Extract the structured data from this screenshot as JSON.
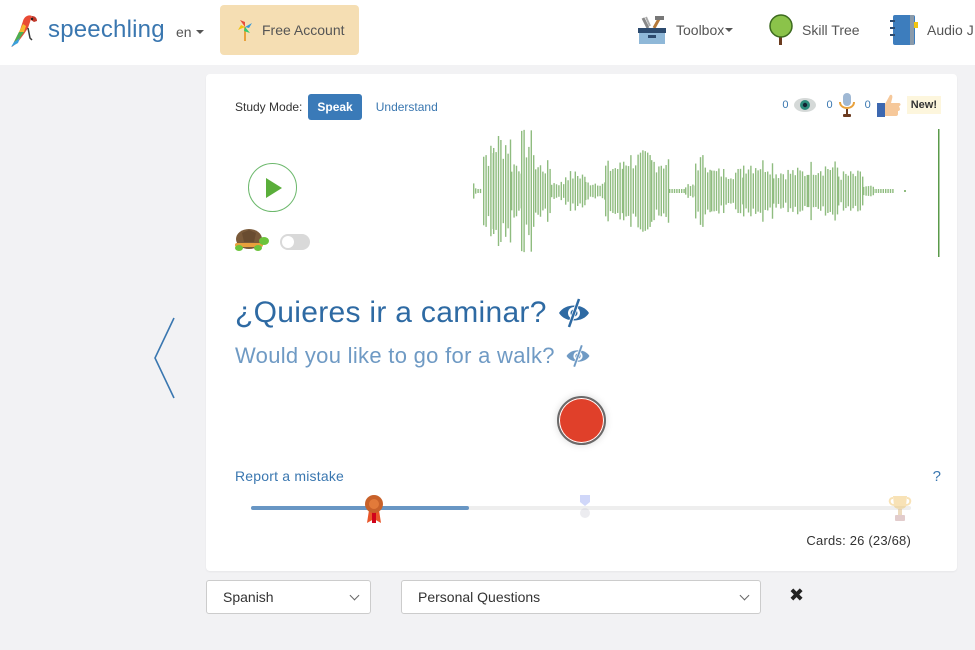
{
  "navbar": {
    "brand": "speechling",
    "language": "en",
    "free_account": "Free Account",
    "items": [
      {
        "label": "Toolbox",
        "icon": "toolbox-icon",
        "has_dropdown": true
      },
      {
        "label": "Skill Tree",
        "icon": "tree-icon",
        "has_dropdown": false
      },
      {
        "label": "Audio J",
        "icon": "notebook-icon",
        "has_dropdown": false
      }
    ]
  },
  "card": {
    "study_mode_label": "Study Mode:",
    "modes": [
      {
        "label": "Speak",
        "active": true
      },
      {
        "label": "Understand",
        "active": false
      }
    ],
    "stats": {
      "viewed": "0",
      "recorded": "0",
      "liked": "0",
      "new_badge": "New!"
    },
    "slow_audio_toggle": false,
    "target_sentence": "¿Quieres ir a caminar?",
    "native_sentence": "Would you like to go for a walk?",
    "report_mistake": "Report a mistake",
    "help": "?",
    "progress": {
      "fraction": 0.33,
      "milestones": [
        "bronze-medal",
        "silver-medal",
        "gold-trophy"
      ]
    },
    "cards_count": "Cards: 26 (23/68)"
  },
  "filters": {
    "language": "Spanish",
    "category": "Personal Questions",
    "clear_icon": "close-icon"
  },
  "colors": {
    "brand_blue": "#3a77b0",
    "active_mode": "#3a7ab8",
    "record_red": "#e0402a",
    "waveform_green": "#8fbc7f",
    "free_account_bg": "#f5deb3"
  }
}
